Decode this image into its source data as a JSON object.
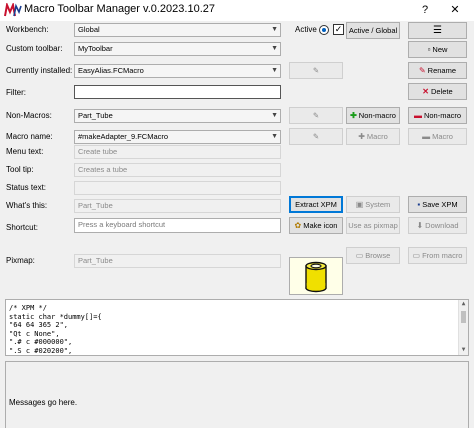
{
  "window": {
    "title": "Macro Toolbar Manager v.0.2023.10.27",
    "help": "?",
    "close": "✕"
  },
  "rows": {
    "workbench": {
      "label": "Workbench:",
      "value": "Global"
    },
    "custom_toolbar": {
      "label": "Custom toolbar:",
      "value": "MyToolbar"
    },
    "currently_installed": {
      "label": "Currently installed:",
      "value": "EasyAlias.FCMacro"
    },
    "filter": {
      "label": "Filter:",
      "value": ""
    },
    "non_macros": {
      "label": "Non-Macros:",
      "value": "Part_Tube"
    },
    "macro_name": {
      "label": "Macro name:",
      "value": "#makeAdapter_9.FCMacro"
    },
    "menu_text": {
      "label": "Menu text:",
      "value": "Create tube"
    },
    "tool_tip": {
      "label": "Tool tip:",
      "value": "Creates a tube"
    },
    "status_text": {
      "label": "Status text:",
      "value": ""
    },
    "whats_this": {
      "label": "What's this:",
      "value": "Part_Tube"
    },
    "shortcut": {
      "label": "Shortcut:",
      "placeholder": "Press a keyboard shortcut"
    },
    "pixmap": {
      "label": "Pixmap:",
      "value": "Part_Tube"
    }
  },
  "active": {
    "label": "Active",
    "toggle_label": "Active / Global"
  },
  "menu_icon": "☰",
  "buttons": {
    "new": "New",
    "rename": "Rename",
    "delete": "Delete",
    "add_non_macro": "Non-macro",
    "remove_non_macro": "Non-macro",
    "add_macro": "Macro",
    "remove_macro": "Macro",
    "extract_xpm": "Extract XPM",
    "system": "System",
    "save_xpm": "Save XPM",
    "make_icon": "Make icon",
    "use_as_pixmap": "Use as pixmap",
    "download": "Download",
    "browse": "Browse",
    "from_macro": "From macro"
  },
  "xpm_lines": [
    "/* XPM */",
    "static char *dummy[]={",
    "\"64 64 365 2\",",
    "\"Qt c None\",",
    "\".# c #000000\",",
    "\".S c #020200\","
  ],
  "messages": "Messages go here.",
  "colors": {
    "accent": "#0078d7",
    "logo_red": "#c8102e",
    "tube_yellow": "#f0e000"
  }
}
